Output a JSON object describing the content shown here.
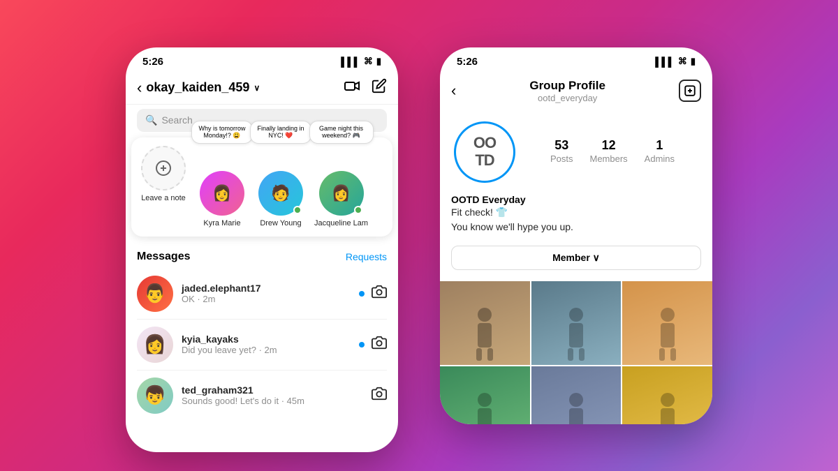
{
  "background": {
    "gradient": "linear-gradient(135deg, #f9485b, #c92b8a, #8b5fcf)"
  },
  "left_phone": {
    "status_bar": {
      "time": "5:26",
      "signal": "▌▌▌",
      "wifi": "WiFi",
      "battery": "🔋"
    },
    "nav": {
      "back_arrow": "‹",
      "title": "okay_kaiden_459",
      "chevron": "∨",
      "video_icon": "video",
      "edit_icon": "edit"
    },
    "search_placeholder": "Search",
    "notes": [
      {
        "id": "self",
        "label": "Leave a note",
        "note_text": null,
        "has_plus": true
      },
      {
        "id": "kyra",
        "label": "Kyra Marie",
        "note_text": "Why is tomorrow Monday!? 😩",
        "has_plus": false,
        "online": false
      },
      {
        "id": "drew",
        "label": "Drew Young",
        "note_text": "Finally landing in NYC! ❤️",
        "has_plus": false,
        "online": true
      },
      {
        "id": "jacqueline",
        "label": "Jacqueline Lam",
        "note_text": "Game night this weekend? 🎮",
        "has_plus": false,
        "online": true
      }
    ],
    "messages_section": {
      "title": "Messages",
      "requests_label": "Requests"
    },
    "messages": [
      {
        "username": "jaded.elephant17",
        "preview": "OK · 2m",
        "unread": true
      },
      {
        "username": "kyia_kayaks",
        "preview": "Did you leave yet? · 2m",
        "unread": true
      },
      {
        "username": "ted_graham321",
        "preview": "Sounds good! Let's do it · 45m",
        "unread": false
      }
    ]
  },
  "right_phone": {
    "status_bar": {
      "time": "5:26",
      "signal": "▌▌▌",
      "wifi": "WiFi",
      "battery": "🔋"
    },
    "nav": {
      "back_arrow": "‹",
      "title": "Group Profile",
      "subtitle": "ootd_everyday",
      "add_icon": "+"
    },
    "group_avatar_text": "OO\nTD",
    "stats": [
      {
        "number": "53",
        "label": "Posts"
      },
      {
        "number": "12",
        "label": "Members"
      },
      {
        "number": "1",
        "label": "Admins"
      }
    ],
    "bio": {
      "name": "OOTD Everyday",
      "line1": "Fit check! 👕",
      "line2": "You know we'll hype you up."
    },
    "member_button": "Member ∨",
    "photos": [
      {
        "id": 1,
        "color": "#8d6e63"
      },
      {
        "id": 2,
        "color": "#607d8b"
      },
      {
        "id": 3,
        "color": "#ef9a9a"
      },
      {
        "id": 4,
        "color": "#a5d6a7"
      },
      {
        "id": 5,
        "color": "#b39ddb"
      },
      {
        "id": 6,
        "color": "#ffcc02"
      }
    ]
  }
}
